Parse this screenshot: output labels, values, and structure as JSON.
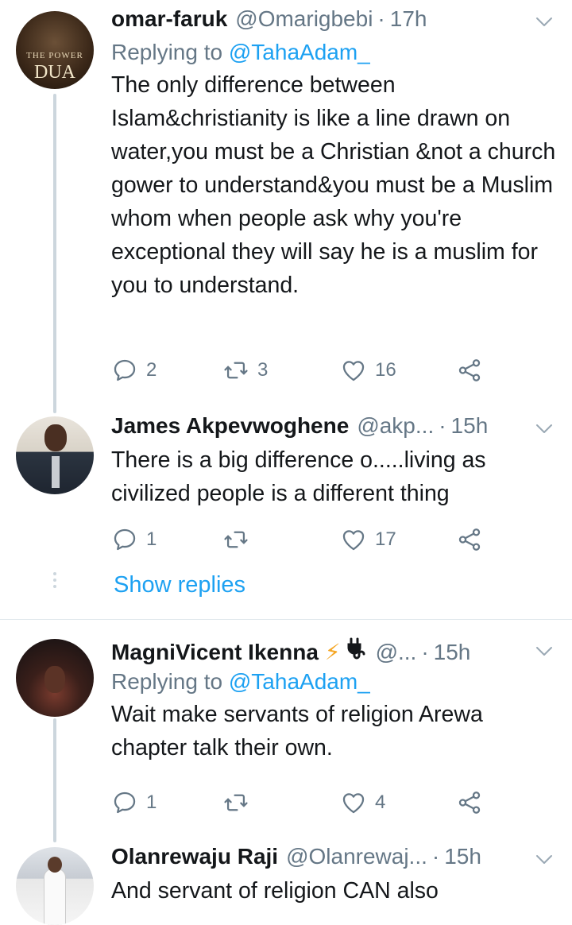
{
  "tweets": [
    {
      "name": "omar-faruk",
      "handle": "@Omarigbebi",
      "time": "17h",
      "replying_prefix": "Replying to",
      "replying_to": "@TahaAdam_",
      "text": "The only difference between Islam&christianity is like a line drawn on water,you must be a Christian &not a church gower to understand&you must be a Muslim whom when people ask why you're exceptional they will say he is a muslim for you to understand.",
      "replies": "2",
      "retweets": "3",
      "likes": "16",
      "avatar_caption": "DUA",
      "avatar_caption_small": "THE POWER"
    },
    {
      "name": "James Akpevwoghene",
      "handle": "@akp...",
      "time": "15h",
      "text": "There is a big difference o.....living as civilized people is a different thing",
      "replies": "1",
      "retweets": "",
      "likes": "17"
    },
    {
      "name": "MagniVicent Ikenna",
      "handle": "@...",
      "time": "15h",
      "replying_prefix": "Replying to",
      "replying_to": "@TahaAdam_",
      "text": "Wait make servants of religion Arewa chapter talk their own.",
      "replies": "1",
      "retweets": "",
      "likes": "4",
      "emoji": "⚡"
    },
    {
      "name": "Olanrewaju Raji",
      "handle": "@Olanrewaj...",
      "time": "15h",
      "text": "And servant of religion CAN also"
    }
  ],
  "show_replies": "Show replies",
  "separator": "·",
  "colors": {
    "link": "#1da1f2",
    "secondary": "#657786",
    "divider": "#e1e8ed",
    "thread": "#ccd6dd"
  }
}
